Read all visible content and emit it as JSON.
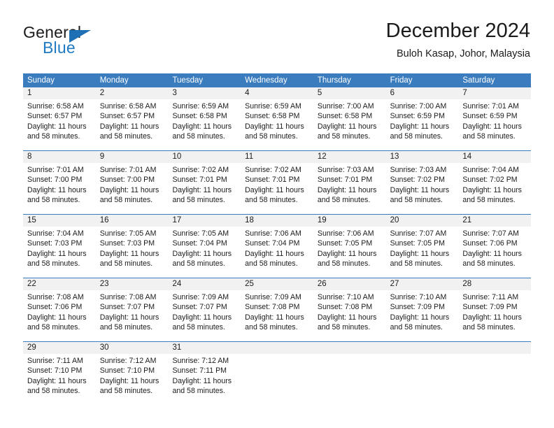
{
  "brand": {
    "name_part1": "General",
    "name_part2": "Blue",
    "logo_icon": "triangle-logo-icon",
    "accent_color": "#1f7ac4"
  },
  "header": {
    "title": "December 2024",
    "subtitle": "Buloh Kasap, Johor, Malaysia"
  },
  "calendar": {
    "header_bg_color": "#3a7cbe",
    "daynum_bg_color": "#f1f1f1",
    "weekday_headers": [
      "Sunday",
      "Monday",
      "Tuesday",
      "Wednesday",
      "Thursday",
      "Friday",
      "Saturday"
    ],
    "weeks": [
      {
        "days": [
          {
            "num": "1",
            "sunrise": "Sunrise: 6:58 AM",
            "sunset": "Sunset: 6:57 PM",
            "daylight1": "Daylight: 11 hours",
            "daylight2": "and 58 minutes."
          },
          {
            "num": "2",
            "sunrise": "Sunrise: 6:58 AM",
            "sunset": "Sunset: 6:57 PM",
            "daylight1": "Daylight: 11 hours",
            "daylight2": "and 58 minutes."
          },
          {
            "num": "3",
            "sunrise": "Sunrise: 6:59 AM",
            "sunset": "Sunset: 6:58 PM",
            "daylight1": "Daylight: 11 hours",
            "daylight2": "and 58 minutes."
          },
          {
            "num": "4",
            "sunrise": "Sunrise: 6:59 AM",
            "sunset": "Sunset: 6:58 PM",
            "daylight1": "Daylight: 11 hours",
            "daylight2": "and 58 minutes."
          },
          {
            "num": "5",
            "sunrise": "Sunrise: 7:00 AM",
            "sunset": "Sunset: 6:58 PM",
            "daylight1": "Daylight: 11 hours",
            "daylight2": "and 58 minutes."
          },
          {
            "num": "6",
            "sunrise": "Sunrise: 7:00 AM",
            "sunset": "Sunset: 6:59 PM",
            "daylight1": "Daylight: 11 hours",
            "daylight2": "and 58 minutes."
          },
          {
            "num": "7",
            "sunrise": "Sunrise: 7:01 AM",
            "sunset": "Sunset: 6:59 PM",
            "daylight1": "Daylight: 11 hours",
            "daylight2": "and 58 minutes."
          }
        ]
      },
      {
        "days": [
          {
            "num": "8",
            "sunrise": "Sunrise: 7:01 AM",
            "sunset": "Sunset: 7:00 PM",
            "daylight1": "Daylight: 11 hours",
            "daylight2": "and 58 minutes."
          },
          {
            "num": "9",
            "sunrise": "Sunrise: 7:01 AM",
            "sunset": "Sunset: 7:00 PM",
            "daylight1": "Daylight: 11 hours",
            "daylight2": "and 58 minutes."
          },
          {
            "num": "10",
            "sunrise": "Sunrise: 7:02 AM",
            "sunset": "Sunset: 7:01 PM",
            "daylight1": "Daylight: 11 hours",
            "daylight2": "and 58 minutes."
          },
          {
            "num": "11",
            "sunrise": "Sunrise: 7:02 AM",
            "sunset": "Sunset: 7:01 PM",
            "daylight1": "Daylight: 11 hours",
            "daylight2": "and 58 minutes."
          },
          {
            "num": "12",
            "sunrise": "Sunrise: 7:03 AM",
            "sunset": "Sunset: 7:01 PM",
            "daylight1": "Daylight: 11 hours",
            "daylight2": "and 58 minutes."
          },
          {
            "num": "13",
            "sunrise": "Sunrise: 7:03 AM",
            "sunset": "Sunset: 7:02 PM",
            "daylight1": "Daylight: 11 hours",
            "daylight2": "and 58 minutes."
          },
          {
            "num": "14",
            "sunrise": "Sunrise: 7:04 AM",
            "sunset": "Sunset: 7:02 PM",
            "daylight1": "Daylight: 11 hours",
            "daylight2": "and 58 minutes."
          }
        ]
      },
      {
        "days": [
          {
            "num": "15",
            "sunrise": "Sunrise: 7:04 AM",
            "sunset": "Sunset: 7:03 PM",
            "daylight1": "Daylight: 11 hours",
            "daylight2": "and 58 minutes."
          },
          {
            "num": "16",
            "sunrise": "Sunrise: 7:05 AM",
            "sunset": "Sunset: 7:03 PM",
            "daylight1": "Daylight: 11 hours",
            "daylight2": "and 58 minutes."
          },
          {
            "num": "17",
            "sunrise": "Sunrise: 7:05 AM",
            "sunset": "Sunset: 7:04 PM",
            "daylight1": "Daylight: 11 hours",
            "daylight2": "and 58 minutes."
          },
          {
            "num": "18",
            "sunrise": "Sunrise: 7:06 AM",
            "sunset": "Sunset: 7:04 PM",
            "daylight1": "Daylight: 11 hours",
            "daylight2": "and 58 minutes."
          },
          {
            "num": "19",
            "sunrise": "Sunrise: 7:06 AM",
            "sunset": "Sunset: 7:05 PM",
            "daylight1": "Daylight: 11 hours",
            "daylight2": "and 58 minutes."
          },
          {
            "num": "20",
            "sunrise": "Sunrise: 7:07 AM",
            "sunset": "Sunset: 7:05 PM",
            "daylight1": "Daylight: 11 hours",
            "daylight2": "and 58 minutes."
          },
          {
            "num": "21",
            "sunrise": "Sunrise: 7:07 AM",
            "sunset": "Sunset: 7:06 PM",
            "daylight1": "Daylight: 11 hours",
            "daylight2": "and 58 minutes."
          }
        ]
      },
      {
        "days": [
          {
            "num": "22",
            "sunrise": "Sunrise: 7:08 AM",
            "sunset": "Sunset: 7:06 PM",
            "daylight1": "Daylight: 11 hours",
            "daylight2": "and 58 minutes."
          },
          {
            "num": "23",
            "sunrise": "Sunrise: 7:08 AM",
            "sunset": "Sunset: 7:07 PM",
            "daylight1": "Daylight: 11 hours",
            "daylight2": "and 58 minutes."
          },
          {
            "num": "24",
            "sunrise": "Sunrise: 7:09 AM",
            "sunset": "Sunset: 7:07 PM",
            "daylight1": "Daylight: 11 hours",
            "daylight2": "and 58 minutes."
          },
          {
            "num": "25",
            "sunrise": "Sunrise: 7:09 AM",
            "sunset": "Sunset: 7:08 PM",
            "daylight1": "Daylight: 11 hours",
            "daylight2": "and 58 minutes."
          },
          {
            "num": "26",
            "sunrise": "Sunrise: 7:10 AM",
            "sunset": "Sunset: 7:08 PM",
            "daylight1": "Daylight: 11 hours",
            "daylight2": "and 58 minutes."
          },
          {
            "num": "27",
            "sunrise": "Sunrise: 7:10 AM",
            "sunset": "Sunset: 7:09 PM",
            "daylight1": "Daylight: 11 hours",
            "daylight2": "and 58 minutes."
          },
          {
            "num": "28",
            "sunrise": "Sunrise: 7:11 AM",
            "sunset": "Sunset: 7:09 PM",
            "daylight1": "Daylight: 11 hours",
            "daylight2": "and 58 minutes."
          }
        ]
      },
      {
        "days": [
          {
            "num": "29",
            "sunrise": "Sunrise: 7:11 AM",
            "sunset": "Sunset: 7:10 PM",
            "daylight1": "Daylight: 11 hours",
            "daylight2": "and 58 minutes."
          },
          {
            "num": "30",
            "sunrise": "Sunrise: 7:12 AM",
            "sunset": "Sunset: 7:10 PM",
            "daylight1": "Daylight: 11 hours",
            "daylight2": "and 58 minutes."
          },
          {
            "num": "31",
            "sunrise": "Sunrise: 7:12 AM",
            "sunset": "Sunset: 7:11 PM",
            "daylight1": "Daylight: 11 hours",
            "daylight2": "and 58 minutes."
          },
          {
            "num": "",
            "sunrise": "",
            "sunset": "",
            "daylight1": "",
            "daylight2": ""
          },
          {
            "num": "",
            "sunrise": "",
            "sunset": "",
            "daylight1": "",
            "daylight2": ""
          },
          {
            "num": "",
            "sunrise": "",
            "sunset": "",
            "daylight1": "",
            "daylight2": ""
          },
          {
            "num": "",
            "sunrise": "",
            "sunset": "",
            "daylight1": "",
            "daylight2": ""
          }
        ]
      }
    ]
  }
}
